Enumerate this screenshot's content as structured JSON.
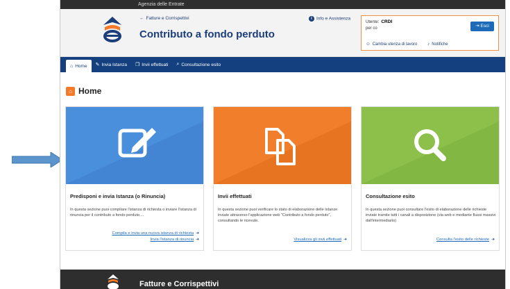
{
  "topbar": {
    "agency": "Agenzia delle Entrate"
  },
  "header": {
    "breadcrumb": "Fatture e Corrispettivi",
    "title": "Contributo a fondo perduto",
    "info_link": "Info e Assistenza"
  },
  "user": {
    "label": "Utente:",
    "name": "CRDI",
    "per_conto": "per co",
    "exit": "Esci",
    "change_user": "Cambia utenza di lavoro",
    "notifications": "Notifiche"
  },
  "nav": {
    "items": [
      {
        "label": "Home",
        "icon": "home-icon"
      },
      {
        "label": "Invia Istanza",
        "icon": "edit-icon"
      },
      {
        "label": "Invii effettuati",
        "icon": "copy-icon"
      },
      {
        "label": "Consultazione esito",
        "icon": "search-icon"
      }
    ]
  },
  "page": {
    "title": "Home"
  },
  "cards": [
    {
      "title": "Predisponi e invia Istanza (o Rinuncia)",
      "desc": "In questa sezione puoi compilare l'istanza di richiesta o inviare l'istanza di rinuncia per il contributo a fondo perduto ...",
      "links": [
        "Compila e invia una nuova istanza di richiesta",
        "Invia l'istanza di rinuncia"
      ],
      "color": "#4a8fdc",
      "icon": "edit-icon"
    },
    {
      "title": "Invii effettuati",
      "desc": "In questa sezione puoi verificare lo stato di elaborazione delle Istanze inviate attraverso l'applicazione web \"Contributo a fondo perduto\", consultando le ricevute.",
      "links": [
        "Visualizza gli invii effettuati"
      ],
      "color": "#f07e2a",
      "icon": "copy-icon"
    },
    {
      "title": "Consultazione esito",
      "desc": "In questa sezione puoi consultare l'esito di elaborazione delle richieste inviate tramite tutti i canali a disposizione (via web e mediante flussi massivi dall'intermediario)",
      "links": [
        "Consulta l'esito delle richieste"
      ],
      "color": "#8cc04b",
      "icon": "search-icon"
    }
  ],
  "footer": {
    "title": "Fatture e Corrispettivi"
  },
  "colors": {
    "nav": "#14407f",
    "accent": "#f47a2a",
    "pointer": "#5b95cc"
  }
}
